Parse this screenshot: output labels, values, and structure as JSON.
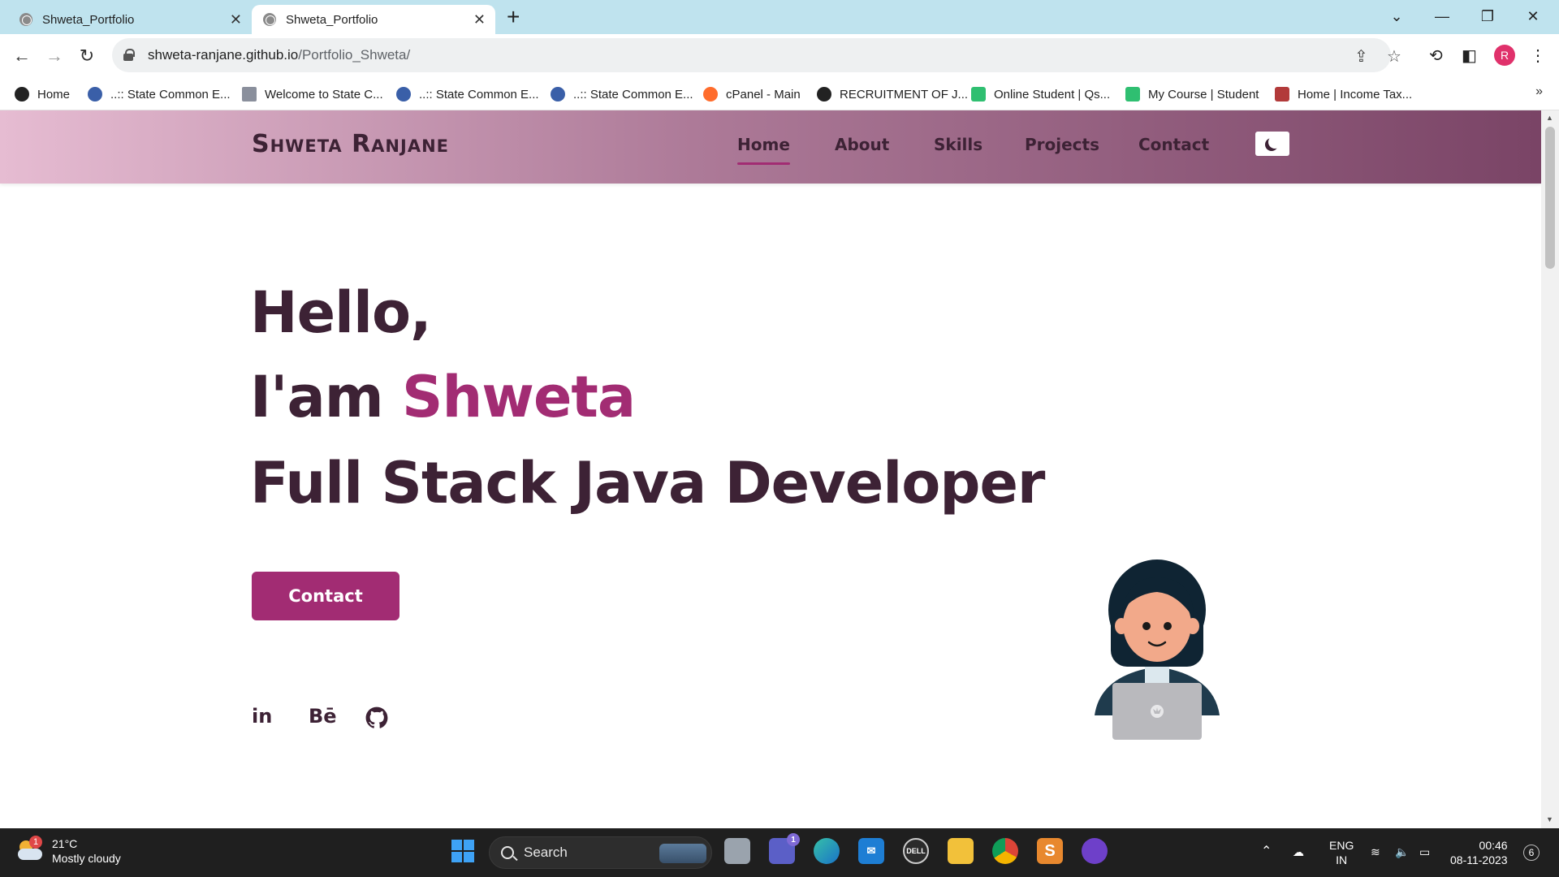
{
  "browser": {
    "tabs": [
      {
        "title": "Shweta_Portfolio",
        "active": false
      },
      {
        "title": "Shweta_Portfolio",
        "active": true
      }
    ],
    "new_tab_symbol": "+",
    "url_host": "shweta-ranjane.github.io",
    "url_path": "/Portfolio_Shweta/",
    "profile_initial": "R",
    "bookmarks": [
      {
        "label": "Home",
        "icon": "globe-icon",
        "color": "#222222"
      },
      {
        "label": "..:: State Common E...",
        "icon": "cet-icon",
        "color": "#3a5fa8"
      },
      {
        "label": "Welcome to State C...",
        "icon": "building-icon",
        "color": "#8a8f9c"
      },
      {
        "label": "..:: State Common E...",
        "icon": "cet-icon",
        "color": "#3a5fa8"
      },
      {
        "label": "..:: State Common E...",
        "icon": "cet-icon",
        "color": "#3a5fa8"
      },
      {
        "label": "cPanel - Main",
        "icon": "cpanel-icon",
        "color": "#ff6c2c"
      },
      {
        "label": "RECRUITMENT OF J...",
        "icon": "globe-icon",
        "color": "#222222"
      },
      {
        "label": "Online Student | Qs...",
        "icon": "qspiders-icon",
        "color": "#2fbf71"
      },
      {
        "label": "My Course | Student",
        "icon": "qspiders-icon",
        "color": "#2fbf71"
      },
      {
        "label": "Home | Income Tax...",
        "icon": "emblem-icon",
        "color": "#b23a3a"
      }
    ]
  },
  "site": {
    "logo": "Shweta Ranjane",
    "nav": [
      "Home",
      "About",
      "Skills",
      "Projects",
      "Contact"
    ],
    "active_nav": "Home",
    "hero": {
      "greeting": "Hello,",
      "intro_prefix": "I'am ",
      "name": "Shweta",
      "role": "Full Stack Java Developer"
    },
    "contact_button": "Contact",
    "social": [
      {
        "label": "in",
        "icon": "linkedin-icon"
      },
      {
        "label": "Bē",
        "icon": "behance-icon"
      },
      {
        "label": "",
        "icon": "github-icon"
      }
    ],
    "colors": {
      "primary": "#a22c73",
      "text": "#3d2235",
      "header_start": "#e6bcd2",
      "header_end": "#7a4466"
    }
  },
  "taskbar": {
    "weather_temp": "21°C",
    "weather_desc": "Mostly cloudy",
    "weather_badge": "1",
    "search_label": "Search",
    "teams_badge": "1",
    "language": "ENG",
    "region": "IN",
    "time": "00:46",
    "date": "08-11-2023",
    "notifications": "6"
  }
}
